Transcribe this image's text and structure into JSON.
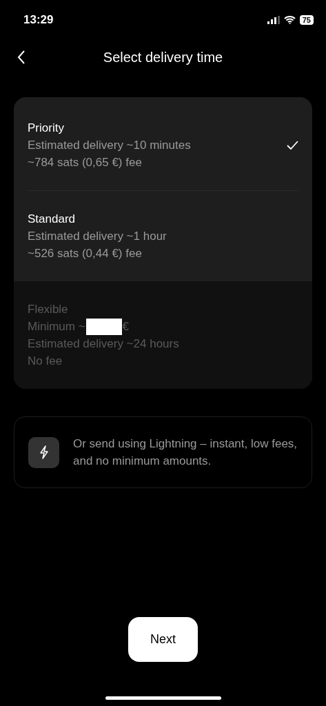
{
  "status_bar": {
    "time": "13:29",
    "battery": "75"
  },
  "header": {
    "title": "Select delivery time"
  },
  "options": [
    {
      "title": "Priority",
      "lines": [
        "Estimated delivery ~10 minutes",
        "~784 sats (0,65 €) fee"
      ],
      "selected": true,
      "disabled": false
    },
    {
      "title": "Standard",
      "lines": [
        "Estimated delivery ~1 hour",
        "~526 sats (0,44 €) fee"
      ],
      "selected": false,
      "disabled": false
    },
    {
      "title": "Flexible",
      "minimum": {
        "prefix": "Minimum ~",
        "suffix": "€"
      },
      "lines": [
        "Estimated delivery ~24 hours",
        "No fee"
      ],
      "selected": false,
      "disabled": true
    }
  ],
  "lightning_note": {
    "text": "Or send using Lightning – instant, low fees, and no minimum amounts."
  },
  "next_button": {
    "label": "Next"
  }
}
